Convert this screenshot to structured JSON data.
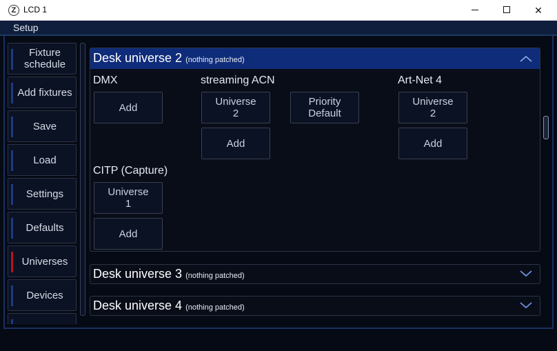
{
  "window": {
    "app_icon_glyph": "Z",
    "title": "LCD 1",
    "minimize": "",
    "maximize": "",
    "close": "✕"
  },
  "setup": {
    "label": "Setup"
  },
  "sidebar": {
    "items": [
      {
        "label": "Fixture schedule",
        "active": false
      },
      {
        "label": "Add fixtures",
        "active": false
      },
      {
        "label": "Save",
        "active": false
      },
      {
        "label": "Load",
        "active": false
      },
      {
        "label": "Settings",
        "active": false
      },
      {
        "label": "Defaults",
        "active": false
      },
      {
        "label": "Universes",
        "active": true
      },
      {
        "label": "Devices",
        "active": false
      },
      {
        "label": "",
        "active": false
      }
    ]
  },
  "panels": [
    {
      "title": "Desk universe 2",
      "status": "(nothing patched)",
      "expanded": true,
      "sections": {
        "dmx": {
          "label": "DMX",
          "add": "Add"
        },
        "sacn": {
          "label": "streaming ACN",
          "universe_label": "Universe",
          "universe_value": "2",
          "priority_label": "Priority",
          "priority_value": "Default",
          "add": "Add"
        },
        "artnet": {
          "label": "Art-Net 4",
          "universe_label": "Universe",
          "universe_value": "2",
          "add": "Add"
        },
        "citp": {
          "label": "CITP (Capture)",
          "universe_label": "Universe",
          "universe_value": "1",
          "add": "Add"
        }
      }
    },
    {
      "title": "Desk universe 3",
      "status": "(nothing patched)",
      "expanded": false
    },
    {
      "title": "Desk universe 4",
      "status": "(nothing patched)",
      "expanded": false
    }
  ],
  "colors": {
    "header_active": "#0f2c7a",
    "indicator": "#1e3a80",
    "indicator_active": "#b4141e",
    "chevron": "#6f8fe0"
  },
  "icons": {
    "collapse": "chevron-up-icon",
    "expand": "chevron-down-icon"
  }
}
